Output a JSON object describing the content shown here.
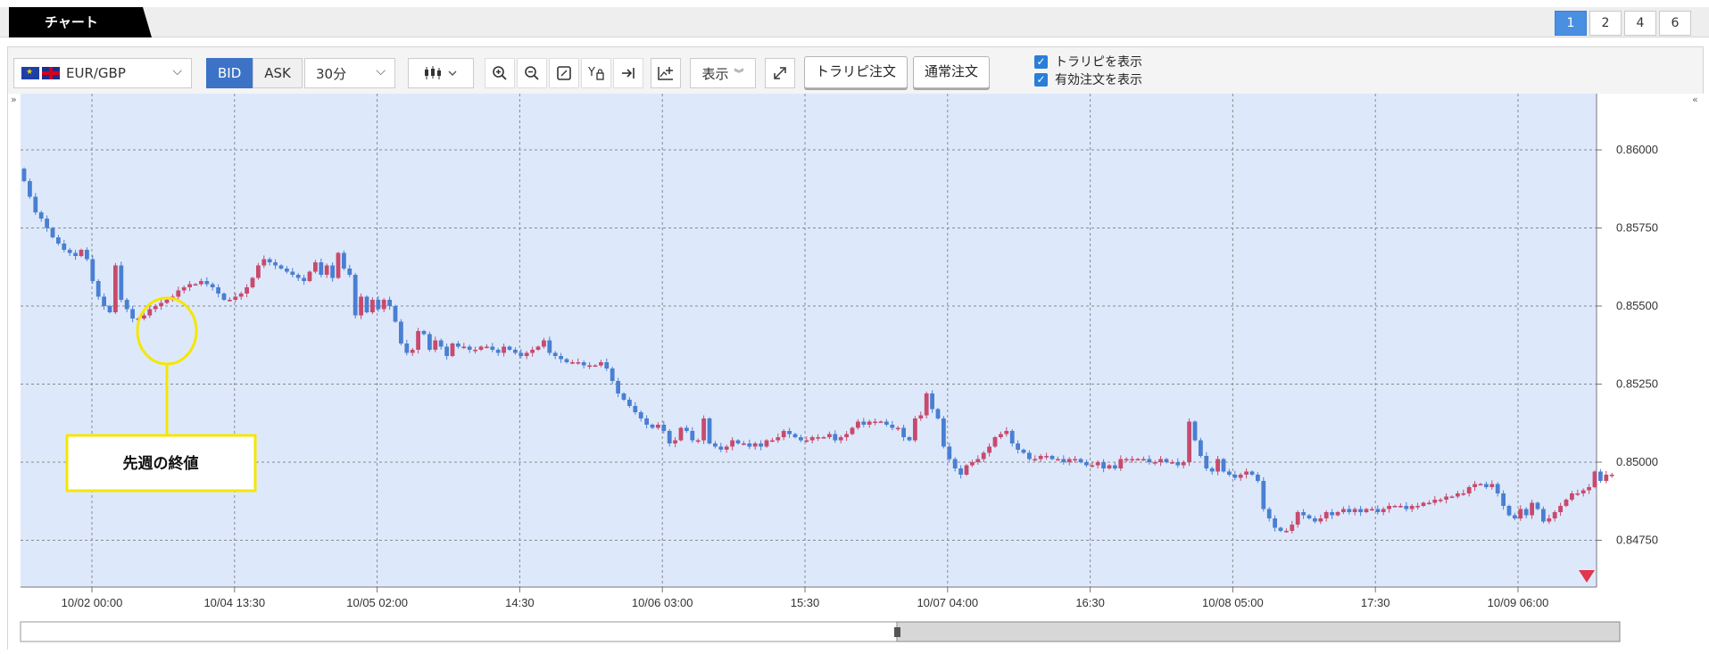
{
  "header": {
    "tab_label": "チャート",
    "pages": [
      "1",
      "2",
      "4",
      "6"
    ],
    "active_page": "1"
  },
  "toolbar": {
    "pair": "EUR/GBP",
    "bid_label": "BID",
    "ask_label": "ASK",
    "interval": "30分",
    "display_label": "表示",
    "trailing_order_label": "トラリピ注文",
    "normal_order_label": "通常注文",
    "check_trailing": "トラリピを表示",
    "check_active_orders": "有効注文を表示"
  },
  "colors": {
    "plot_bg": "#dde9fb",
    "up": "#c84a6e",
    "down": "#4a7fd2",
    "annotation": "#f5e600"
  },
  "annotation": {
    "text": "先週の終値"
  },
  "chart_data": {
    "type": "candlestick",
    "title": "",
    "ylim": [
      0.846,
      0.8618
    ],
    "y_ticks": [
      "0.86000",
      "0.85750",
      "0.85500",
      "0.85250",
      "0.85000",
      "0.84750"
    ],
    "x_tick_labels": [
      "10/02 00:00",
      "10/04 13:30",
      "10/05 02:00",
      "14:30",
      "10/06 03:00",
      "15:30",
      "10/07 04:00",
      "16:30",
      "10/08 05:00",
      "17:30",
      "10/09 06:00"
    ],
    "grid": true,
    "close_series": [
      0.859,
      0.8585,
      0.858,
      0.8578,
      0.8575,
      0.8572,
      0.857,
      0.8568,
      0.8567,
      0.8566,
      0.8568,
      0.8565,
      0.8558,
      0.8553,
      0.855,
      0.8548,
      0.8563,
      0.8552,
      0.8549,
      0.8546,
      0.8546,
      0.8547,
      0.8549,
      0.855,
      0.8551,
      0.8552,
      0.8553,
      0.8555,
      0.8556,
      0.8557,
      0.8557,
      0.8558,
      0.8557,
      0.8556,
      0.8554,
      0.8552,
      0.8552,
      0.8553,
      0.8554,
      0.8556,
      0.8559,
      0.8563,
      0.8565,
      0.8564,
      0.8563,
      0.8562,
      0.8561,
      0.856,
      0.8559,
      0.8558,
      0.8561,
      0.8564,
      0.856,
      0.8563,
      0.8559,
      0.8567,
      0.8562,
      0.856,
      0.8547,
      0.8553,
      0.8548,
      0.8552,
      0.8549,
      0.8552,
      0.855,
      0.8545,
      0.8538,
      0.8535,
      0.8536,
      0.8542,
      0.8541,
      0.8536,
      0.8539,
      0.8537,
      0.8534,
      0.8538,
      0.8537,
      0.8537,
      0.8536,
      0.8536,
      0.8537,
      0.8537,
      0.8536,
      0.8535,
      0.8537,
      0.8536,
      0.8535,
      0.8534,
      0.8535,
      0.8536,
      0.8537,
      0.8539,
      0.8535,
      0.8534,
      0.8533,
      0.8532,
      0.8532,
      0.8532,
      0.8531,
      0.8531,
      0.8531,
      0.8532,
      0.853,
      0.8526,
      0.8522,
      0.852,
      0.8518,
      0.8516,
      0.8514,
      0.8512,
      0.8511,
      0.8512,
      0.851,
      0.8506,
      0.8507,
      0.8511,
      0.851,
      0.8507,
      0.8507,
      0.8514,
      0.8506,
      0.8505,
      0.8504,
      0.8505,
      0.8507,
      0.8506,
      0.8506,
      0.8505,
      0.8506,
      0.8505,
      0.8507,
      0.8507,
      0.8508,
      0.851,
      0.8509,
      0.8508,
      0.8507,
      0.8507,
      0.8508,
      0.8508,
      0.8508,
      0.8509,
      0.8507,
      0.8508,
      0.8509,
      0.8511,
      0.8513,
      0.8512,
      0.8513,
      0.8513,
      0.8513,
      0.8512,
      0.8511,
      0.8511,
      0.8508,
      0.8507,
      0.8514,
      0.8515,
      0.8522,
      0.8517,
      0.8514,
      0.8505,
      0.8501,
      0.8498,
      0.8496,
      0.8499,
      0.85,
      0.8501,
      0.8503,
      0.8505,
      0.8508,
      0.8509,
      0.851,
      0.8506,
      0.8504,
      0.8503,
      0.8501,
      0.8501,
      0.8502,
      0.8502,
      0.8501,
      0.8501,
      0.85,
      0.8501,
      0.8501,
      0.85,
      0.8499,
      0.8499,
      0.85,
      0.8498,
      0.8499,
      0.8498,
      0.8501,
      0.8501,
      0.8501,
      0.8501,
      0.8501,
      0.85,
      0.85,
      0.8501,
      0.85,
      0.85,
      0.8499,
      0.85,
      0.8513,
      0.8507,
      0.8502,
      0.8498,
      0.8497,
      0.8501,
      0.8497,
      0.8496,
      0.8495,
      0.8496,
      0.8497,
      0.8496,
      0.8494,
      0.8485,
      0.8482,
      0.8479,
      0.8478,
      0.8478,
      0.848,
      0.8484,
      0.8483,
      0.8482,
      0.8481,
      0.8482,
      0.8484,
      0.8483,
      0.8484,
      0.8485,
      0.8484,
      0.8485,
      0.8484,
      0.8485,
      0.8485,
      0.8484,
      0.8485,
      0.8486,
      0.8486,
      0.8486,
      0.8485,
      0.8486,
      0.8486,
      0.8487,
      0.8487,
      0.8488,
      0.8488,
      0.8489,
      0.8489,
      0.849,
      0.849,
      0.8492,
      0.8493,
      0.8493,
      0.8492,
      0.8493,
      0.849,
      0.8486,
      0.8483,
      0.8482,
      0.8485,
      0.8483,
      0.8487,
      0.8485,
      0.8481,
      0.8482,
      0.8484,
      0.8486,
      0.8488,
      0.849,
      0.849,
      0.8491,
      0.8492,
      0.8497,
      0.8494,
      0.8496,
      0.8496
    ]
  }
}
